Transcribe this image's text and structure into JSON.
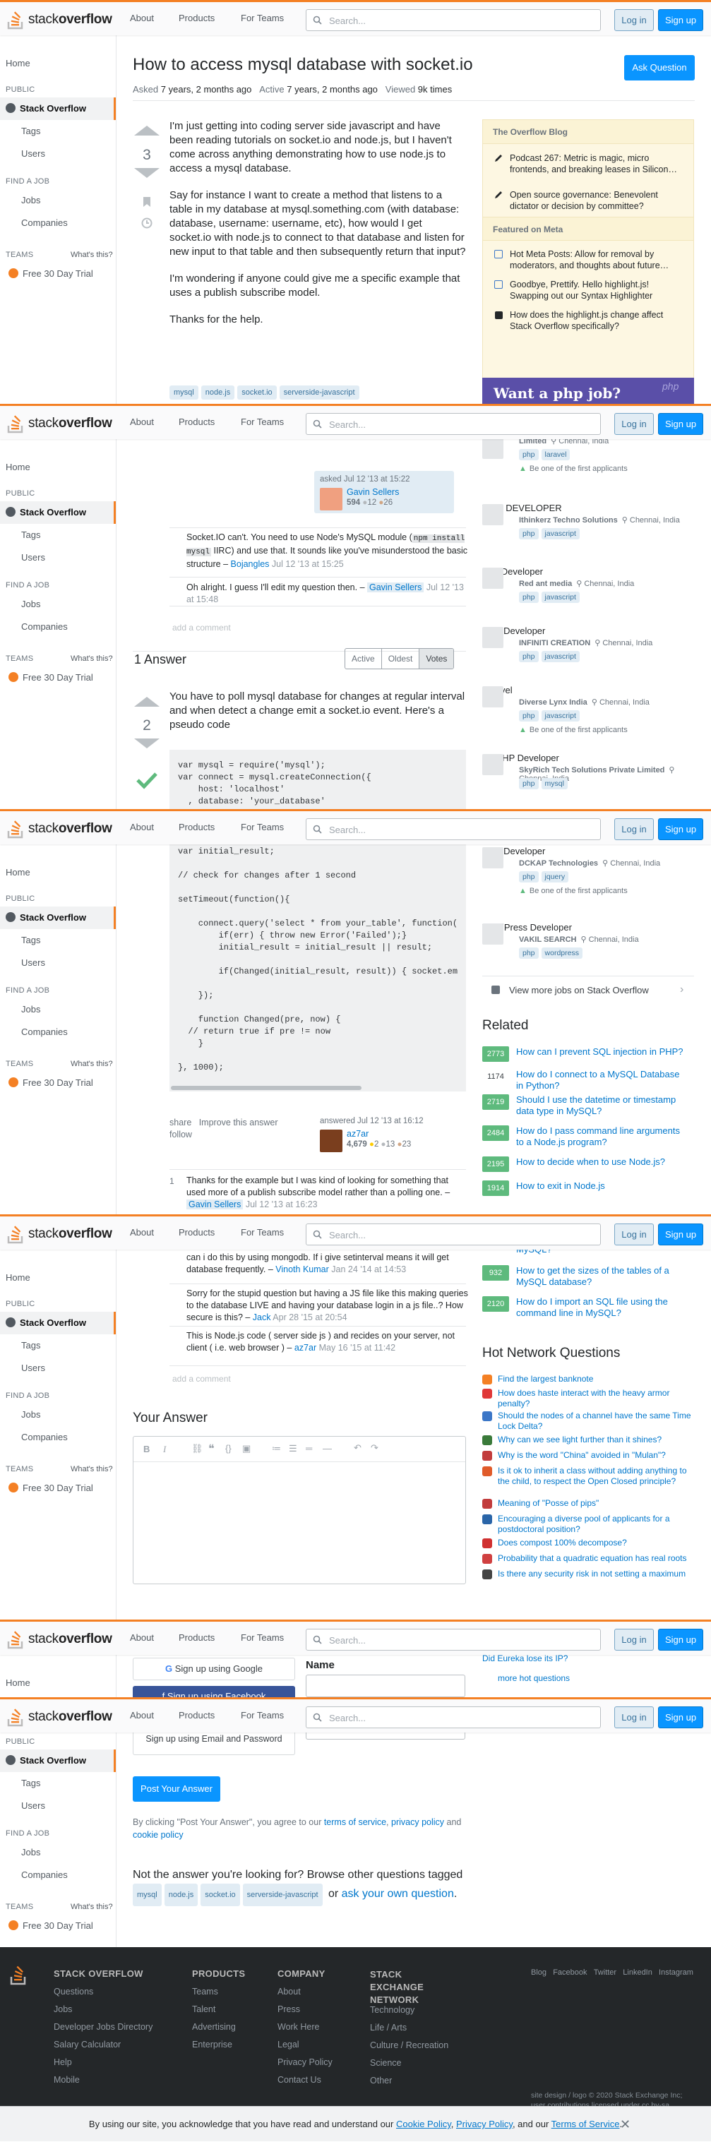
{
  "header": {
    "logo_text_a": "stack",
    "logo_text_b": "overflow",
    "nav": [
      "About",
      "Products",
      "For Teams"
    ],
    "search_placeholder": "Search...",
    "login": "Log in",
    "signup": "Sign up"
  },
  "leftnav": {
    "home": "Home",
    "public": "PUBLIC",
    "stack_overflow": "Stack Overflow",
    "tags": "Tags",
    "users": "Users",
    "find_job": "FIND A JOB",
    "jobs": "Jobs",
    "companies": "Companies",
    "teams": "TEAMS",
    "whats_this": "What's this?",
    "trial": "Free 30 Day Trial"
  },
  "question": {
    "title": "How to access mysql database with socket.io",
    "ask_button": "Ask Question",
    "asked_label": "Asked",
    "asked": "7 years, 2 months ago",
    "active_label": "Active",
    "active": "7 years, 2 months ago",
    "viewed_label": "Viewed",
    "viewed": "9k times",
    "votes": "3",
    "p1": "I'm just getting into coding server side javascript and have been reading tutorials on socket.io and node.js, but I haven't come across anything demonstrating how to use node.js to access a mysql database.",
    "p2": "Say for instance I want to create a method that listens to a table in my database at mysql.something.com (with database: database, username: username, etc), how would I get socket.io with node.js to connect to that database and listen for new input to that table and then subsequently return that input?",
    "p3": "I'm wondering if anyone could give me a specific example that uses a publish subscribe model.",
    "p4": "Thanks for the help.",
    "tags": [
      "mysql",
      "node.js",
      "socket.io",
      "serverside-javascript"
    ],
    "asked_card": "asked Jul 12 '13 at 15:22",
    "author": "Gavin Sellers",
    "rep": "594",
    "silver": "12",
    "bronze": "26"
  },
  "sidebar": {
    "blog_title": "The Overflow Blog",
    "blog": [
      "Podcast 267: Metric is magic, micro frontends, and breaking leases in Silicon…",
      "Open source governance: Benevolent dictator or decision by committee?"
    ],
    "meta_title": "Featured on Meta",
    "meta": [
      "Hot Meta Posts: Allow for removal by moderators, and thoughts about future…",
      "Goodbye, Prettify. Hello highlight.js! Swapping out our Syntax Highlighter",
      "How does the highlight.js change affect Stack Overflow specifically?"
    ],
    "ad": "Want a php job?",
    "ad_logo": "php"
  },
  "comments_q": [
    {
      "text": "Socket.IO can't. You need to use Node's MySQL module (",
      "code1": "npm install mysql",
      "text2": " IIRC) and use that. It sounds like you've misunderstood the basic structure – ",
      "user": "Bojangles",
      "time": "Jul 12 '13 at 15:25"
    },
    {
      "text": "Oh alright. I guess I'll edit my question then. – ",
      "user": "Gavin Sellers",
      "time": "Jul 12 '13 at 15:48"
    }
  ],
  "add_comment": "add a comment",
  "answers": {
    "count": "1 Answer",
    "sort": [
      "Active",
      "Oldest",
      "Votes"
    ],
    "votes": "2",
    "text": "You have to poll mysql database for changes at regular interval and when detect a change emit a socket.io event. Here's a pseudo code",
    "share": "share",
    "improve": "Improve this answer",
    "follow": "follow",
    "answered": "answered Jul 12 '13 at 16:12",
    "author": "az7ar",
    "rep": "4,679",
    "gold": "2",
    "silver": "13",
    "bronze": "23"
  },
  "code1": [
    "var mysql = require('mysql');",
    "var connect = mysql.createConnection({",
    "    host: 'localhost'",
    "  , database: 'your_database'"
  ],
  "code2": [
    "var initial_result;",
    "",
    "// check for changes after 1 second",
    "",
    "setTimeout(function(){",
    "",
    "    connect.query('select * from your_table', function(",
    "        if(err) { throw new Error('Failed');}",
    "        initial_result = initial_result || result;",
    "",
    "        if(Changed(initial_result, result)) { socket.em",
    "",
    "    });",
    "",
    "    function Changed(pre, now) {",
    "  // return true if pre != now",
    "    }",
    "",
    "}, 1000);"
  ],
  "comments_a": [
    {
      "votes": "1",
      "text": "Thanks for the example but I was kind of looking for something that used more of a publish subscribe model rather than a polling one. – ",
      "user": "Gavin Sellers",
      "time": "Jul 12 '13 at 16:23"
    },
    {
      "text": "can i do this by using mongodb. If i give setinterval means it will get database frequently. – ",
      "user": "Vinoth Kumar",
      "time": "Jan 24 '14 at 14:53"
    },
    {
      "text": "Sorry for the stupid question but having a JS file like this making queries to the database LIVE and having your database login in a js file..? How secure is this? – ",
      "user": "Jack",
      "time": "Apr 28 '15 at 20:54"
    },
    {
      "text": "This is Node.js code ( server side js ) and recides on your server, not client ( i.e. web browser ) – ",
      "user": "az7ar",
      "time": "May 16 '15 at 11:42"
    }
  ],
  "jobs": [
    {
      "title": "",
      "company": "Limited",
      "loc": "Chennai, India",
      "tags": [
        "php",
        "laravel"
      ],
      "note": "Be one of the first applicants"
    },
    {
      "title": "WEB DEVELOPER",
      "company": "Ithinkerz Techno Solutions",
      "loc": "Chennai, India",
      "tags": [
        "php",
        "javascript"
      ]
    },
    {
      "title": "Php Developer",
      "company": "Red ant media",
      "loc": "Chennai, India",
      "tags": [
        "php",
        "javascript"
      ]
    },
    {
      "title": "PHP Developer",
      "company": "INFINITI CREATION",
      "loc": "Chennai, India",
      "tags": [
        "php",
        "javascript"
      ]
    },
    {
      "title": "Laravel",
      "company": "Diverse Lynx India",
      "loc": "Chennai, India",
      "tags": [
        "php",
        "javascript"
      ],
      "note": "Be one of the first applicants"
    },
    {
      "title": "Sr. PHP Developer",
      "company": "SkyRich Tech Solutions Private Limited",
      "loc": "Chennai, India",
      "tags": [
        "php",
        "mysql"
      ]
    },
    {
      "title": "PHP Developer",
      "company": "DCKAP Technologies",
      "loc": "Chennai, India",
      "tags": [
        "php",
        "jquery"
      ],
      "note": "Be one of the first applicants"
    },
    {
      "title": "WordPress Developer",
      "company": "VAKIL SEARCH",
      "loc": "Chennai, India",
      "tags": [
        "php",
        "wordpress"
      ]
    }
  ],
  "view_more_jobs": "View more jobs on Stack Overflow",
  "related_title": "Related",
  "related": [
    {
      "score": "2773",
      "title": "How can I prevent SQL injection in PHP?",
      "accepted": true
    },
    {
      "score": "1174",
      "title": "How do I connect to a MySQL Database in Python?",
      "accepted": false
    },
    {
      "score": "2719",
      "title": "Should I use the datetime or timestamp data type in MySQL?",
      "accepted": true
    },
    {
      "score": "2484",
      "title": "How do I pass command line arguments to a Node.js program?",
      "accepted": true
    },
    {
      "score": "2195",
      "title": "How to decide when to use Node.js?",
      "accepted": true
    },
    {
      "score": "1914",
      "title": "How to exit in Node.js",
      "accepted": true
    },
    {
      "score": "",
      "title": "How to reset AUTO_INCREMENT in MySQL?",
      "accepted": true
    },
    {
      "score": "932",
      "title": "How to get the sizes of the tables of a MySQL database?",
      "accepted": true
    },
    {
      "score": "2120",
      "title": "How do I import an SQL file using the command line in MySQL?",
      "accepted": true
    }
  ],
  "hnq_title": "Hot Network Questions",
  "hnq": [
    "Find the largest banknote",
    "How does haste interact with the heavy armor penalty?",
    "Should the nodes of a channel have the same Time Lock Delta?",
    "Why can we see light further than it shines?",
    "Why is the word \"China\" avoided in \"Mulan\"?",
    "Is it ok to inherit a class without adding anything to the child, to respect the Open Closed principle?",
    "Meaning of \"Posse of pips\"",
    "Encouraging a diverse pool of applicants for a postdoctoral position?",
    "Does compost 100% decompose?",
    "Probability that a quadratic equation has real roots",
    "Is there any security risk in not setting a maximum",
    "Did Eureka lose its IP?"
  ],
  "hnq_colors": [
    "#f48024",
    "#e03838",
    "#3b76c7",
    "#3a7a3a",
    "#c23c3c",
    "#e05b2a",
    "#c23c3c",
    "#2a65a8",
    "#d03030",
    "#d04040",
    "#444444",
    "#3b76c7"
  ],
  "more_hot": "more hot questions",
  "your_answer": "Your Answer",
  "signup": {
    "google": "Sign up using Google",
    "facebook": "Sign up using Facebook",
    "email": "Sign up using Email and Password",
    "name_label": "Name"
  },
  "post_answer": "Post Your Answer",
  "terms": {
    "pre": "By clicking \"Post Your Answer\", you agree to our ",
    "tos": "terms of service",
    "c1": ", ",
    "privacy": "privacy policy",
    "c2": " and ",
    "cookie": "cookie policy"
  },
  "not_answer": {
    "pre": "Not the answer you're looking for? Browse other questions tagged ",
    "or": " or ",
    "ask": "ask your own question",
    "dot": "."
  },
  "footer": {
    "so": "STACK OVERFLOW",
    "so_links": [
      "Questions",
      "Jobs",
      "Developer Jobs Directory",
      "Salary Calculator",
      "Help",
      "Mobile"
    ],
    "products": "PRODUCTS",
    "products_links": [
      "Teams",
      "Talent",
      "Advertising",
      "Enterprise"
    ],
    "company": "COMPANY",
    "company_links": [
      "About",
      "Press",
      "Work Here",
      "Legal",
      "Privacy Policy",
      "Contact Us"
    ],
    "sen": "STACK EXCHANGE NETWORK",
    "sen_links": [
      "Technology",
      "Life / Arts",
      "Culture / Recreation",
      "Science",
      "Other"
    ],
    "social": [
      "Blog",
      "Facebook",
      "Twitter",
      "LinkedIn",
      "Instagram"
    ],
    "legal1": "site design / logo © 2020 Stack Exchange Inc;",
    "legal2": "user contributions licensed under cc by-sa."
  },
  "cookie": {
    "pre": "By using our site, you acknowledge that you have read and understand our ",
    "cp": "Cookie Policy",
    "c": ", ",
    "pp": "Privacy Policy",
    "and": ", and our ",
    "tos": "Terms of Service",
    "dot": "."
  },
  "colors": {
    "accent": "#f48024",
    "blue": "#0a95ff",
    "link": "#0077cc",
    "green": "#5eba7d"
  }
}
